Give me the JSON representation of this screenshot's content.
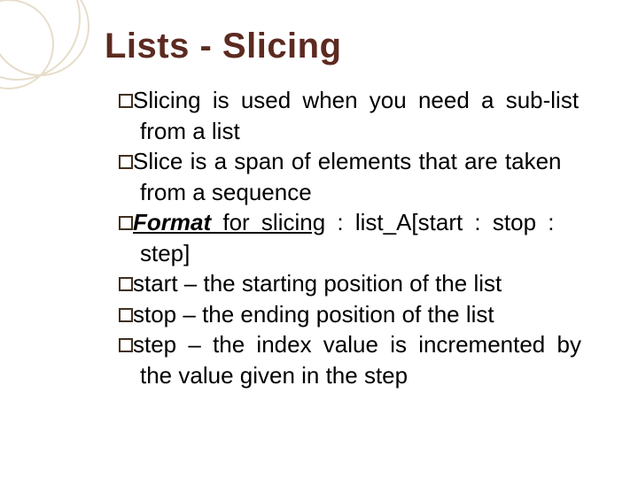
{
  "title": "Lists - Slicing",
  "items": [
    {
      "lead": "Slicing",
      "rest1": " is used when you need a sub-list",
      "cont": "from a list"
    },
    {
      "lead": "Slice",
      "rest1": " is a span of elements that are taken",
      "cont": "from a sequence"
    },
    {
      "format_label": "Format",
      "format_mid": " for ",
      "format_slicing": "slicing",
      "format_rest": " : list_A[start : stop :",
      "cont": "step]"
    },
    {
      "lead": "start",
      "rest1": " – the starting position of the list"
    },
    {
      "lead": "stop",
      "rest1": " – the ending position of the list"
    },
    {
      "lead": "step",
      "rest1": " – the index value is incremented by",
      "cont": "the value given in the step"
    }
  ]
}
